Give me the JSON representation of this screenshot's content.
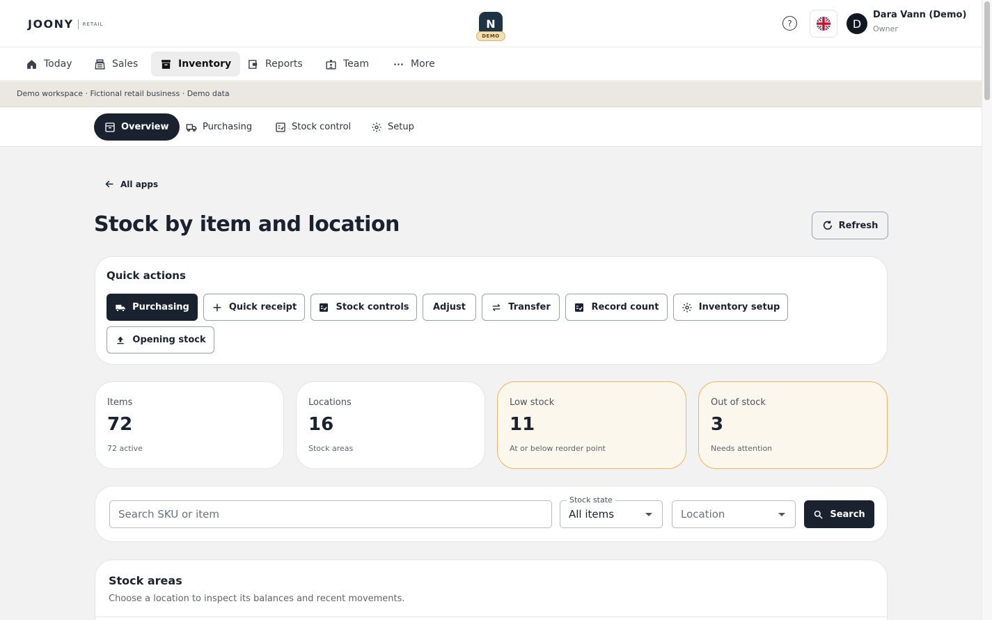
{
  "brand": {
    "logo_main": "JOONY",
    "logo_sub": "RETAIL",
    "badge_letter": "N",
    "badge_tag": "DEMO"
  },
  "user": {
    "initial": "D",
    "name": "Dara Vann (Demo)",
    "role": "Owner"
  },
  "header_icons": {
    "help": "help-circle-icon",
    "language": "uk-flag-icon"
  },
  "main_nav": [
    {
      "label": "Today",
      "icon": "home-icon"
    },
    {
      "label": "Sales",
      "icon": "register-icon"
    },
    {
      "label": "Inventory",
      "icon": "archive-box-icon",
      "active": true
    },
    {
      "label": "Reports",
      "icon": "wallet-icon"
    },
    {
      "label": "Team",
      "icon": "id-badge-icon"
    },
    {
      "label": "More",
      "icon": "more-horizontal-icon"
    }
  ],
  "demo_strip": "Demo workspace · Fictional retail business · Demo data",
  "sub_nav": [
    {
      "label": "Overview",
      "icon": "archive-box-icon",
      "active": true
    },
    {
      "label": "Purchasing",
      "icon": "truck-icon"
    },
    {
      "label": "Stock control",
      "icon": "checklist-icon"
    },
    {
      "label": "Setup",
      "icon": "gear-icon"
    }
  ],
  "back_link": "All apps",
  "page_title": "Stock by item and location",
  "refresh_label": "Refresh",
  "quick_actions": {
    "title": "Quick actions",
    "buttons": [
      {
        "label": "Purchasing",
        "icon": "truck-icon"
      },
      {
        "label": "Quick receipt",
        "icon": "plus-icon"
      },
      {
        "label": "Stock controls",
        "icon": "checklist-icon"
      },
      {
        "label": "Adjust",
        "icon": ""
      },
      {
        "label": "Transfer",
        "icon": "swap-arrows-icon"
      },
      {
        "label": "Record count",
        "icon": "checklist-icon"
      },
      {
        "label": "Inventory setup",
        "icon": "gear-icon"
      },
      {
        "label": "Opening stock",
        "icon": "upload-icon"
      }
    ]
  },
  "stats": [
    {
      "label": "Items",
      "value": "72",
      "sub": "72 active"
    },
    {
      "label": "Locations",
      "value": "16",
      "sub": "Stock areas"
    },
    {
      "label": "Low stock",
      "value": "11",
      "sub": "At or below reorder point"
    },
    {
      "label": "Out of stock",
      "value": "3",
      "sub": "Needs attention"
    }
  ],
  "search": {
    "placeholder": "Search SKU or item",
    "stock_state_label": "Stock state",
    "stock_state_value": "All items",
    "location_placeholder": "Location",
    "button_label": "Search"
  },
  "stock_areas": {
    "title": "Stock areas",
    "subtitle": "Choose a location to inspect its balances and recent movements."
  },
  "colors": {
    "primary": "#1a2230",
    "warning_border": "#f0b45a",
    "warning_bg": "#fcf7ec",
    "demo_strip": "#ebe8e1"
  }
}
